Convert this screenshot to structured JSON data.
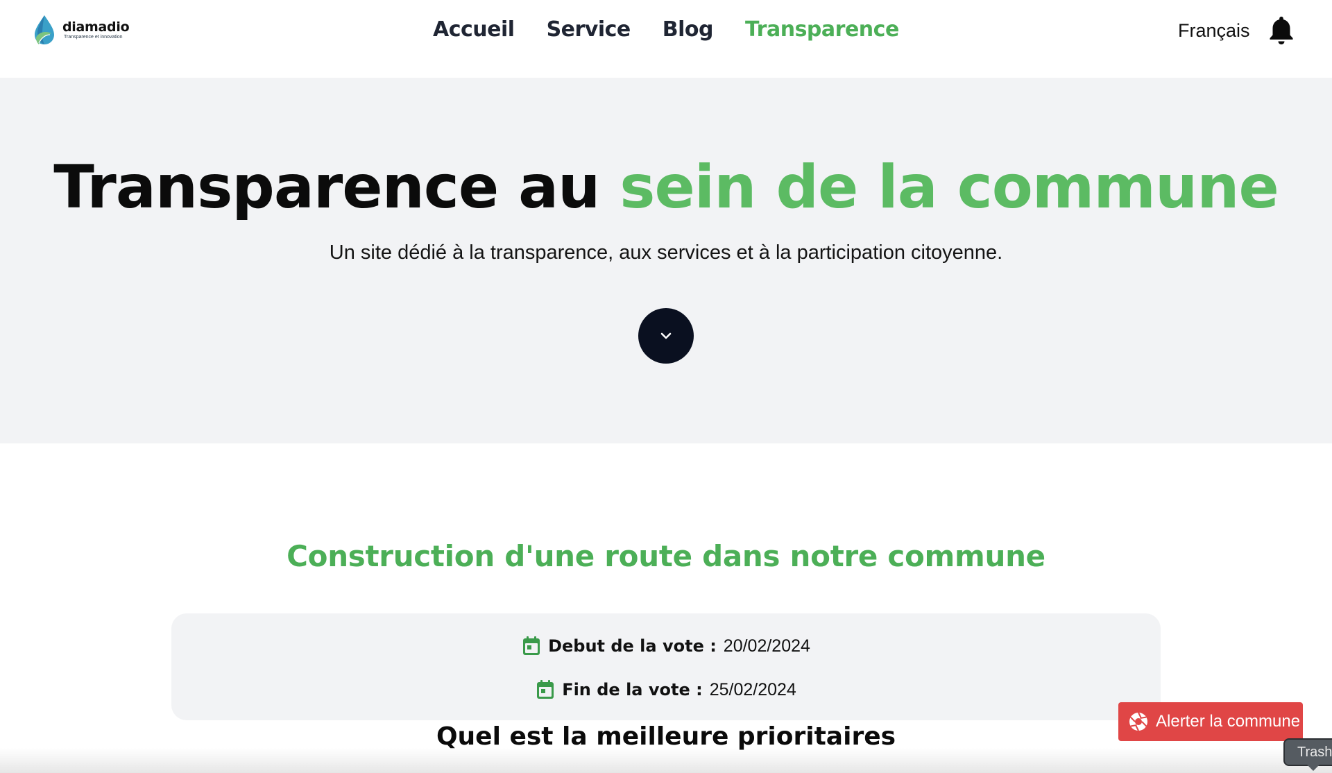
{
  "header": {
    "logo": {
      "name": "diamadio",
      "tagline": "Transparence et innovation",
      "icon": "water-drop-leaf-logo"
    },
    "nav": [
      {
        "label": "Accueil",
        "active": false
      },
      {
        "label": "Service",
        "active": false
      },
      {
        "label": "Blog",
        "active": false
      },
      {
        "label": "Transparence",
        "active": true
      }
    ],
    "language": "Français",
    "notification_icon": "bell-icon"
  },
  "hero": {
    "title_dark": "Transparence au ",
    "title_green": "sein de la commune",
    "subtitle": "Un site dédié à la transparence, aux services et à la participation citoyenne.",
    "scroll_icon": "chevron-down-icon"
  },
  "vote": {
    "title": "Construction d'une route dans notre commune",
    "start_label": "Debut de la vote :",
    "start_value": "20/02/2024",
    "end_label": "Fin de la vote :",
    "end_value": "25/02/2024",
    "question": "Quel est la meilleure prioritaires"
  },
  "floating": {
    "alert_label": "Alerter la commune",
    "alert_icon": "aperture-icon",
    "tooltip": "Trash"
  },
  "colors": {
    "accent_green": "#5cbb63",
    "nav_active": "#4caf57",
    "hero_bg": "#f2f3f5",
    "alert_red": "#e04646",
    "dark": "#0a1020"
  }
}
